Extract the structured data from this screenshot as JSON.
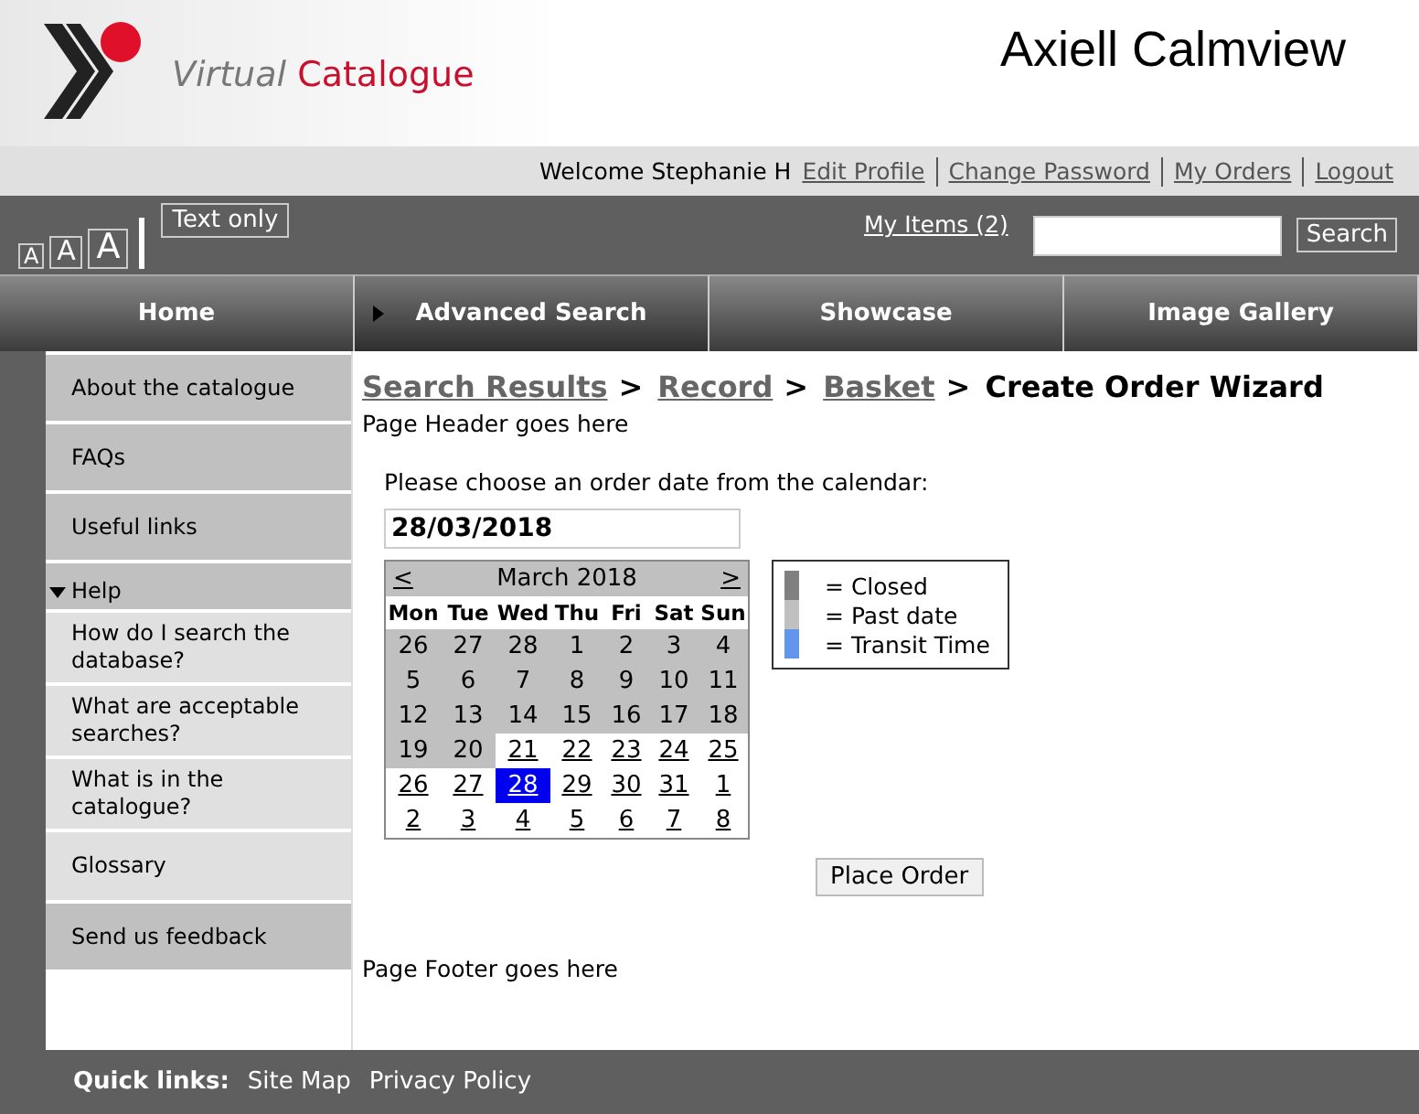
{
  "logo": {
    "word1": "Virtual",
    "word2": "Catalogue"
  },
  "brand": "Axiell Calmview",
  "welcome": "Welcome Stephanie H",
  "user_links": [
    "Edit Profile",
    "Change Password",
    "My Orders",
    "Logout"
  ],
  "font_sizes": [
    "A",
    "A",
    "A"
  ],
  "text_only": "Text only",
  "my_items": "My Items (2)",
  "search": {
    "button": "Search"
  },
  "nav": [
    {
      "label": "Home",
      "selected": false
    },
    {
      "label": "Advanced Search",
      "selected": true
    },
    {
      "label": "Showcase",
      "selected": false
    },
    {
      "label": "Image Gallery",
      "selected": false
    }
  ],
  "sidebar": [
    {
      "label": "About the catalogue"
    },
    {
      "label": "FAQs"
    },
    {
      "label": "Useful links"
    },
    {
      "label": "Help",
      "expanded": true,
      "children": [
        {
          "label": "How do I search the database?"
        },
        {
          "label": "What are acceptable searches?"
        },
        {
          "label": "What is in the catalogue?"
        },
        {
          "label": "Glossary"
        }
      ]
    },
    {
      "label": "Send us feedback"
    }
  ],
  "breadcrumb": [
    {
      "label": "Search Results",
      "link": true,
      "separator": ">"
    },
    {
      "label": "Record",
      "link": true,
      "separator": ">"
    },
    {
      "label": "Basket",
      "link": true,
      "separator": ">"
    },
    {
      "label": "Create Order Wizard",
      "link": false
    }
  ],
  "page_header": "Page Header goes here",
  "prompt": "Please choose an order date from the calendar:",
  "date_value": "28/03/2018",
  "calendar": {
    "prev": "<",
    "month": "March 2018",
    "next": ">",
    "weekdays": [
      "Mon",
      "Tue",
      "Wed",
      "Thu",
      "Fri",
      "Sat",
      "Sun"
    ],
    "weeks": [
      [
        {
          "day": "26",
          "past": true,
          "selected": false
        },
        {
          "day": "27",
          "past": true,
          "selected": false
        },
        {
          "day": "28",
          "past": true,
          "selected": false
        },
        {
          "day": "1",
          "past": true,
          "selected": false
        },
        {
          "day": "2",
          "past": true,
          "selected": false
        },
        {
          "day": "3",
          "past": true,
          "selected": false
        },
        {
          "day": "4",
          "past": true,
          "selected": false
        }
      ],
      [
        {
          "day": "5",
          "past": true,
          "selected": false
        },
        {
          "day": "6",
          "past": true,
          "selected": false
        },
        {
          "day": "7",
          "past": true,
          "selected": false
        },
        {
          "day": "8",
          "past": true,
          "selected": false
        },
        {
          "day": "9",
          "past": true,
          "selected": false
        },
        {
          "day": "10",
          "past": true,
          "selected": false
        },
        {
          "day": "11",
          "past": true,
          "selected": false
        }
      ],
      [
        {
          "day": "12",
          "past": true,
          "selected": false
        },
        {
          "day": "13",
          "past": true,
          "selected": false
        },
        {
          "day": "14",
          "past": true,
          "selected": false
        },
        {
          "day": "15",
          "past": true,
          "selected": false
        },
        {
          "day": "16",
          "past": true,
          "selected": false
        },
        {
          "day": "17",
          "past": true,
          "selected": false
        },
        {
          "day": "18",
          "past": true,
          "selected": false
        }
      ],
      [
        {
          "day": "19",
          "past": true,
          "selected": false
        },
        {
          "day": "20",
          "past": true,
          "selected": false
        },
        {
          "day": "21",
          "past": false,
          "selected": false
        },
        {
          "day": "22",
          "past": false,
          "selected": false
        },
        {
          "day": "23",
          "past": false,
          "selected": false
        },
        {
          "day": "24",
          "past": false,
          "selected": false
        },
        {
          "day": "25",
          "past": false,
          "selected": false
        }
      ],
      [
        {
          "day": "26",
          "past": false,
          "selected": false
        },
        {
          "day": "27",
          "past": false,
          "selected": false
        },
        {
          "day": "28",
          "past": false,
          "selected": true
        },
        {
          "day": "29",
          "past": false,
          "selected": false
        },
        {
          "day": "30",
          "past": false,
          "selected": false
        },
        {
          "day": "31",
          "past": false,
          "selected": false
        },
        {
          "day": "1",
          "past": false,
          "selected": false
        }
      ],
      [
        {
          "day": "2",
          "past": false,
          "selected": false
        },
        {
          "day": "3",
          "past": false,
          "selected": false
        },
        {
          "day": "4",
          "past": false,
          "selected": false
        },
        {
          "day": "5",
          "past": false,
          "selected": false
        },
        {
          "day": "6",
          "past": false,
          "selected": false
        },
        {
          "day": "7",
          "past": false,
          "selected": false
        },
        {
          "day": "8",
          "past": false,
          "selected": false
        }
      ]
    ]
  },
  "legend": [
    {
      "label": "= Closed",
      "color": "#808080"
    },
    {
      "label": "= Past date",
      "color": "#c0c0c0"
    },
    {
      "label": "= Transit Time",
      "color": "#6495ed"
    }
  ],
  "place_order": "Place Order",
  "page_footer": "Page Footer goes here",
  "footer": {
    "label": "Quick links:",
    "links": [
      "Site Map",
      "Privacy Policy"
    ]
  }
}
